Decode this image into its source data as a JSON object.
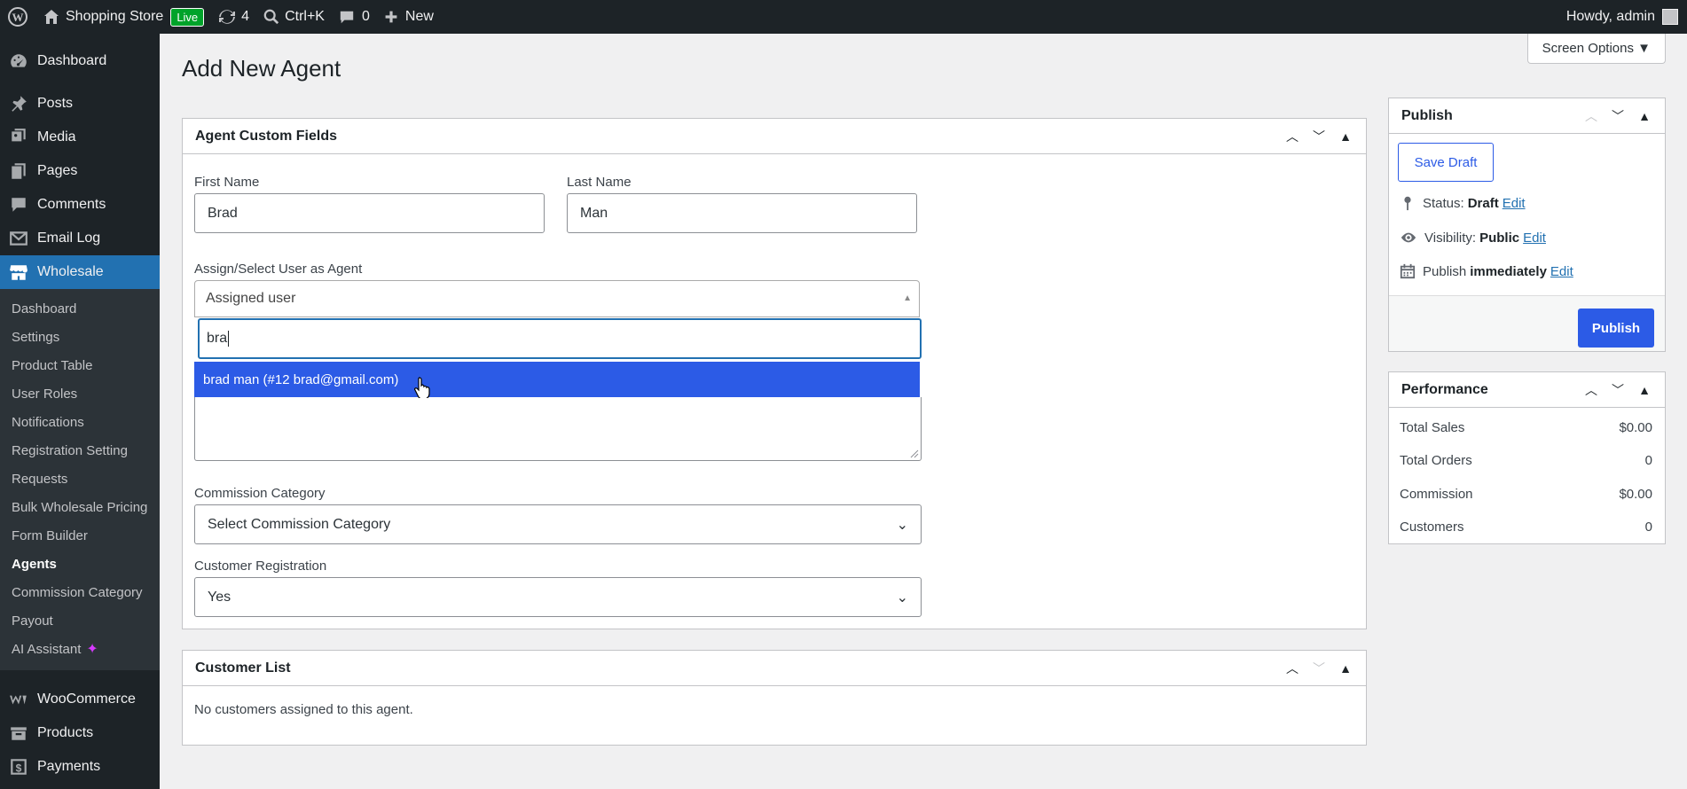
{
  "adminbar": {
    "site_name": "Shopping Store",
    "live_badge": "Live",
    "updates_count": "4",
    "search_shortcut": "Ctrl+K",
    "comments_count": "0",
    "new_label": "New",
    "howdy": "Howdy, admin"
  },
  "sidebar": {
    "top_items": [
      {
        "label": "Dashboard",
        "icon": "dashboard-icon"
      },
      {
        "label": "Posts",
        "icon": "pin-icon"
      },
      {
        "label": "Media",
        "icon": "media-icon"
      },
      {
        "label": "Pages",
        "icon": "pages-icon"
      },
      {
        "label": "Comments",
        "icon": "comment-icon"
      },
      {
        "label": "Email Log",
        "icon": "email-icon"
      },
      {
        "label": "Wholesale",
        "icon": "store-icon"
      }
    ],
    "submenu": [
      "Dashboard",
      "Settings",
      "Product Table",
      "User Roles",
      "Notifications",
      "Registration Setting",
      "Requests",
      "Bulk Wholesale Pricing",
      "Form Builder",
      "Agents",
      "Commission Category",
      "Payout",
      "AI Assistant"
    ],
    "bottom_items": [
      {
        "label": "WooCommerce",
        "icon": "woo-icon"
      },
      {
        "label": "Products",
        "icon": "products-icon"
      },
      {
        "label": "Payments",
        "icon": "payments-icon"
      }
    ]
  },
  "screen_options": "Screen Options ▼",
  "page_title": "Add New Agent",
  "agent_box": {
    "title": "Agent Custom Fields",
    "first_name_label": "First Name",
    "first_name_value": "Brad",
    "last_name_label": "Last Name",
    "last_name_value": "Man",
    "assign_label": "Assign/Select User as Agent",
    "assign_placeholder": "Assigned user",
    "search_value": "bra",
    "option_text": "brad man (#12 brad@gmail.com)",
    "commission_label": "Commission Category",
    "commission_value": "Select Commission Category",
    "registration_label": "Customer Registration",
    "registration_value": "Yes"
  },
  "customer_box": {
    "title": "Customer List",
    "empty_text": "No customers assigned to this agent."
  },
  "publish_box": {
    "title": "Publish",
    "save_draft": "Save Draft",
    "status_label": "Status:",
    "status_value": "Draft",
    "visibility_label": "Visibility:",
    "visibility_value": "Public",
    "publish_label": "Publish",
    "publish_value": "immediately",
    "edit": "Edit",
    "publish_button": "Publish"
  },
  "performance_box": {
    "title": "Performance",
    "rows": [
      {
        "label": "Total Sales",
        "value": "$0.00"
      },
      {
        "label": "Total Orders",
        "value": "0"
      },
      {
        "label": "Commission",
        "value": "$0.00"
      },
      {
        "label": "Customers",
        "value": "0"
      }
    ]
  },
  "colors": {
    "admin_dark": "#1d2327",
    "wp_blue": "#2271b1",
    "accent_blue": "#2c5be6"
  }
}
